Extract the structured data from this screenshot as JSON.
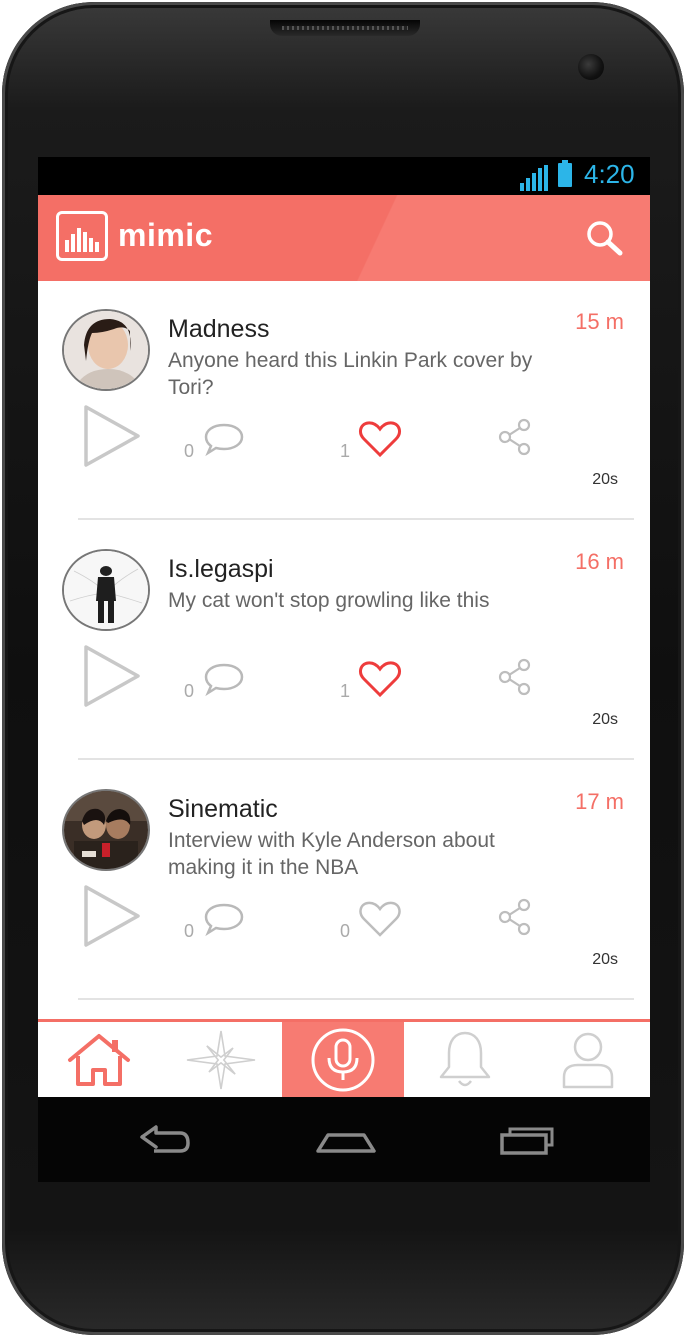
{
  "status": {
    "time": "4:20"
  },
  "app": {
    "name": "mimic",
    "icons": {
      "logo": "equalizer-logo-icon",
      "search": "search-icon"
    }
  },
  "posts": [
    {
      "username": "Madness",
      "time": "15 m",
      "text": "Anyone heard this Linkin Park cover by Tori?",
      "comments": "0",
      "likes": "1",
      "liked": true,
      "duration": "20s"
    },
    {
      "username": "Is.legaspi",
      "time": "16 m",
      "text": "My cat won't stop growling like this",
      "comments": "0",
      "likes": "1",
      "liked": true,
      "duration": "20s"
    },
    {
      "username": "Sinematic",
      "time": "17 m",
      "text": "Interview with Kyle Anderson about making it in the NBA",
      "comments": "0",
      "likes": "0",
      "liked": false,
      "duration": "20s"
    }
  ],
  "tabs": [
    {
      "name": "home",
      "icon": "home-icon",
      "active": false
    },
    {
      "name": "explore",
      "icon": "compass-star-icon",
      "active": false
    },
    {
      "name": "record",
      "icon": "microphone-icon",
      "active": true
    },
    {
      "name": "notifications",
      "icon": "bell-icon",
      "active": false
    },
    {
      "name": "profile",
      "icon": "user-icon",
      "active": false
    }
  ],
  "colors": {
    "accent": "#f46f66",
    "accent_light": "#f77b72",
    "status_blue": "#2cb5e8"
  }
}
